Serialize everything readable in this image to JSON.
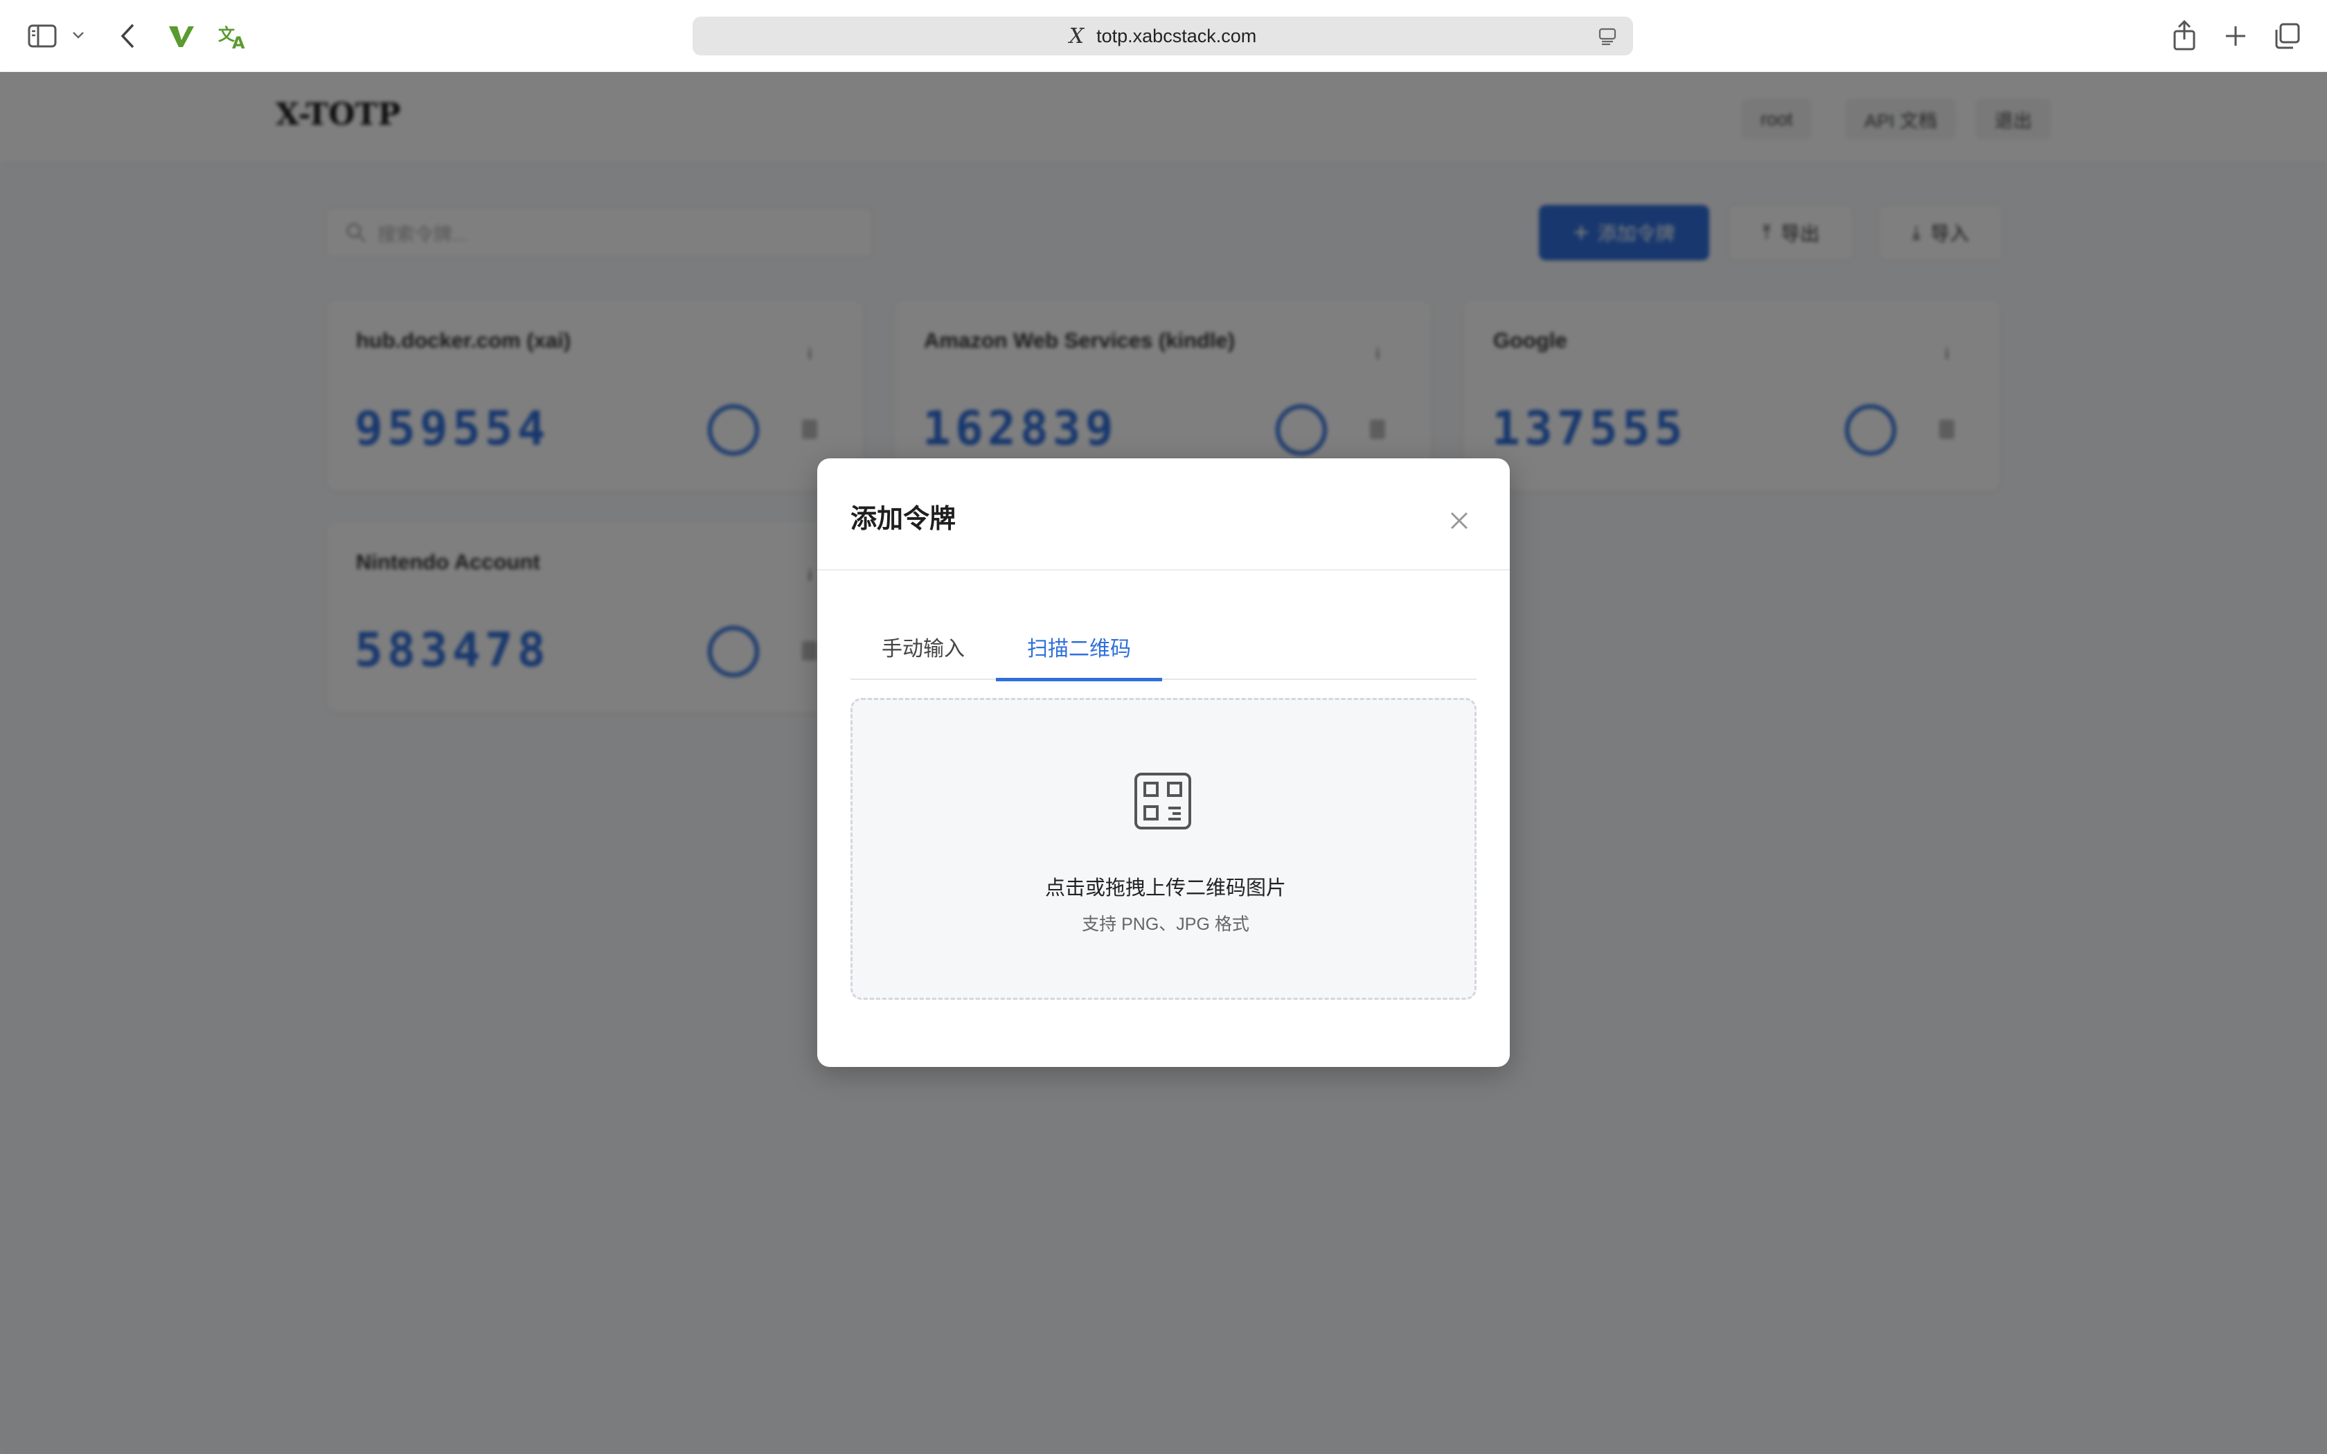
{
  "browser": {
    "url": "totp.xabcstack.com",
    "site_glyph": "𝑋"
  },
  "app": {
    "brand": "X-TOTP",
    "nav": [
      "root",
      "API 文档",
      "退出"
    ],
    "search_placeholder": "搜索令牌...",
    "toolbar": {
      "add_label": "添加令牌",
      "export_label": "导出",
      "import_label": "导入"
    },
    "tokens": [
      {
        "name": "hub.docker.com (xai)",
        "code": "959554"
      },
      {
        "name": "Amazon Web Services (kindle)",
        "code": "162839"
      },
      {
        "name": "Google",
        "code": "137555"
      },
      {
        "name": "Nintendo Account",
        "code": "583478"
      }
    ]
  },
  "modal": {
    "title": "添加令牌",
    "tabs": [
      {
        "label": "手动输入",
        "active": false
      },
      {
        "label": "扫描二维码",
        "active": true
      }
    ],
    "upload": {
      "main_text": "点击或拖拽上传二维码图片",
      "sub_text": "支持 PNG、JPG 格式"
    }
  },
  "colors": {
    "accent": "#2f6fdc",
    "overlay": "rgba(0,0,0,0.5)"
  },
  "icons": {
    "sidebar": "sidebar-icon",
    "back": "back-chevron-icon",
    "extension": "v-extension-icon",
    "translate": "translate-icon",
    "share": "share-icon",
    "new_tab": "plus-icon",
    "tabs_overview": "tabs-icon",
    "close": "close-icon",
    "qr": "qr-code-icon"
  }
}
